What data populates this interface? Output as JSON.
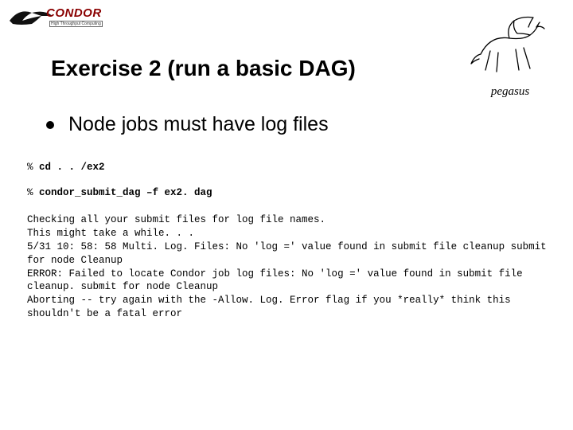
{
  "logos": {
    "condor_name": "CONDOR",
    "condor_tagline": "High Throughput Computing",
    "pegasus_caption": "pegasus"
  },
  "title": "Exercise 2 (run a basic DAG)",
  "bullet": "Node jobs must have log files",
  "terminal": {
    "prompt1": "% ",
    "cmd1": "cd . . /ex2",
    "prompt2": "% ",
    "cmd2": "condor_submit_dag –f ex2. dag",
    "output": "Checking all your submit files for log file names.\nThis might take a while. . .\n5/31 10: 58: 58 Multi. Log. Files: No 'log =' value found in submit file cleanup submit for node Cleanup\nERROR: Failed to locate Condor job log files: No 'log =' value found in submit file cleanup. submit for node Cleanup\nAborting -- try again with the -Allow. Log. Error flag if you *really* think this shouldn't be a fatal error"
  }
}
